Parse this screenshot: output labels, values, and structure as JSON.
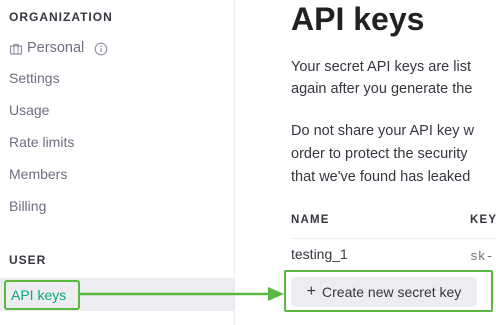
{
  "sidebar": {
    "organization_label": "ORGANIZATION",
    "org_name": "Personal",
    "items": [
      "Settings",
      "Usage",
      "Rate limits",
      "Members",
      "Billing"
    ],
    "user_label": "USER",
    "active_item": "API keys"
  },
  "main": {
    "title": "API keys",
    "para1_line1": "Your secret API keys are list",
    "para1_line2": "again after you generate the",
    "para2_line1": "Do not share your API key w",
    "para2_line2": "order to protect the security",
    "para2_line3": "that we've found has leaked",
    "table": {
      "headers": [
        "NAME",
        "KEY"
      ],
      "rows": [
        {
          "name": "testing_1",
          "key": "sk-"
        }
      ]
    },
    "create_button_label": "Create new secret key"
  },
  "colors": {
    "highlight_green": "#58b840",
    "accent_teal": "#10a37f",
    "active_bg": "#ececf1"
  },
  "icons": [
    "briefcase-icon",
    "info-icon",
    "plus-icon",
    "arrow-right-icon"
  ]
}
